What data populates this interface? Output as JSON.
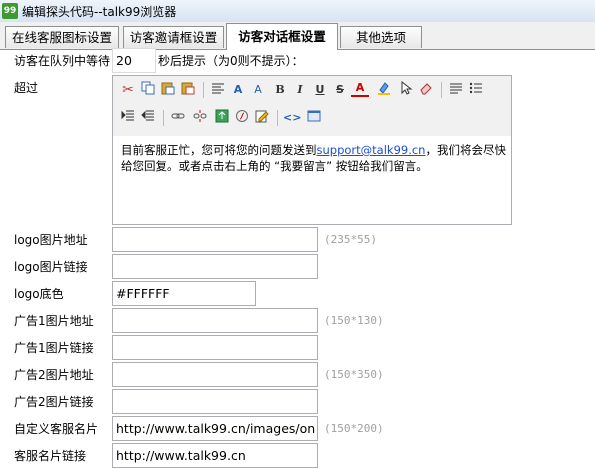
{
  "window": {
    "title": "编辑探头代码--talk99浏览器",
    "icon_text": "99"
  },
  "tabs": [
    {
      "label": "在线客服图标设置"
    },
    {
      "label": "访客邀请框设置"
    },
    {
      "label": "访客对话框设置",
      "active": true
    },
    {
      "label": "其他选项"
    }
  ],
  "queue": {
    "prefix": "访客在队列中等待",
    "value": "20",
    "suffix": "秒后提示（为0则不提示）："
  },
  "exceed": {
    "label": "超过"
  },
  "editor": {
    "content_before": "目前客服正忙，您可将您的问题发送到",
    "email": "support@talk99.cn",
    "content_after": "，我们将会尽快给您回复。或者点击右上角的 “我要留言” 按钮给我们留言。"
  },
  "fields": {
    "logo_url": {
      "label": "logo图片地址",
      "value": "",
      "hint": "(235*55)"
    },
    "logo_link": {
      "label": "logo图片链接",
      "value": ""
    },
    "logo_bg": {
      "label": "logo底色",
      "value": "#FFFFFF"
    },
    "ad1_url": {
      "label": "广告1图片地址",
      "value": "",
      "hint": "(150*130)"
    },
    "ad1_link": {
      "label": "广告1图片链接",
      "value": ""
    },
    "ad2_url": {
      "label": "广告2图片地址",
      "value": "",
      "hint": "(150*350)"
    },
    "ad2_link": {
      "label": "广告2图片链接",
      "value": ""
    },
    "custom_card": {
      "label": "自定义客服名片",
      "value": "http://www.talk99.cn/images/on",
      "hint": "(150*200)"
    },
    "card_link": {
      "label": "客服名片链接",
      "value": "http://www.talk99.cn"
    }
  },
  "colors": {
    "link": "#1a4fd0",
    "hint": "#a0a0a0",
    "border": "#abadb3"
  }
}
